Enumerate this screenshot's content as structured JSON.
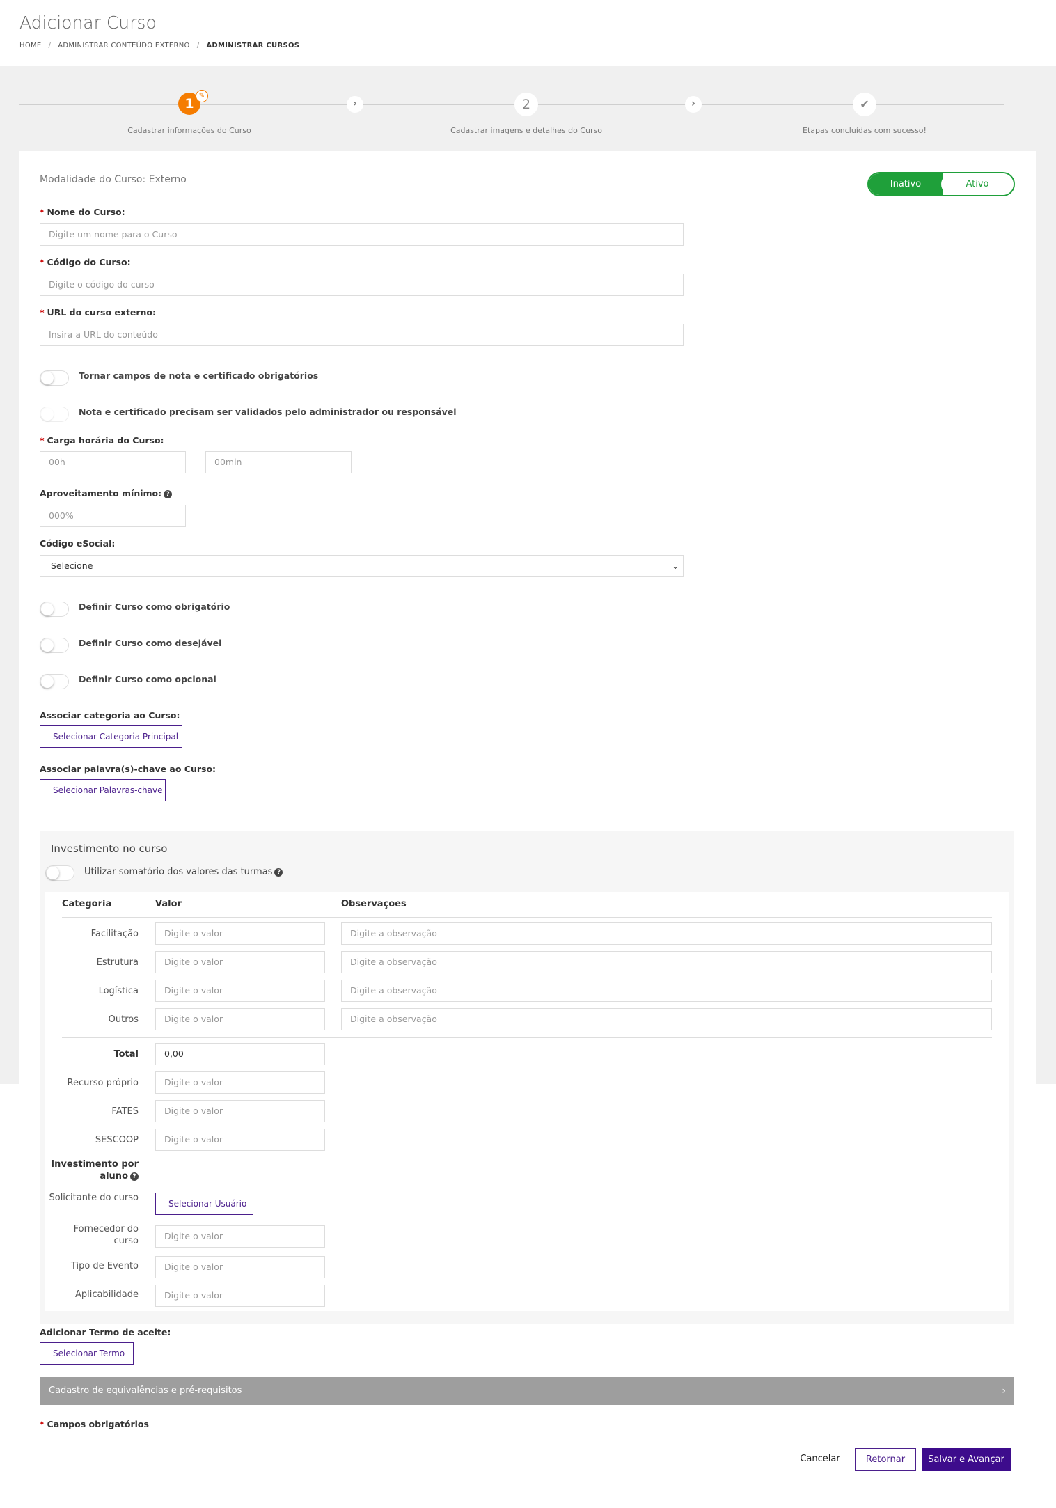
{
  "header": {
    "title": "Adicionar Curso",
    "breadcrumb": [
      "HOME",
      "ADMINISTRAR CONTEÚDO EXTERNO",
      "ADMINISTRAR CURSOS"
    ]
  },
  "stepper": {
    "steps": [
      {
        "number": "1",
        "label": "Cadastrar informações do Curso"
      },
      {
        "number": "2",
        "label": "Cadastrar imagens e detalhes do Curso"
      },
      {
        "number": "",
        "label": "Etapas concluídas com sucesso!"
      }
    ],
    "current_step": 1
  },
  "form": {
    "modalidade": "Modalidade do Curso: Externo",
    "status_switch": {
      "off_label": "Inativo",
      "on_label": "Ativo"
    },
    "nome_label": "Nome do Curso:",
    "nome_placeholder": "Digite um nome para o Curso",
    "codigo_label": "Código do Curso:",
    "codigo_placeholder": "Digite o código do curso",
    "url_label": "URL do curso externo:",
    "url_placeholder": "Insira a URL do conteúdo",
    "toggle_nota_label": "Tornar campos de nota e certificado obrigatórios",
    "toggle_validacao_label": "Nota e certificado precisam ser validados pelo administrador ou responsável",
    "carga_label": "Carga horária do Curso:",
    "carga_horas_placeholder": "00h",
    "carga_min_placeholder": "00min",
    "aproveitamento_label": "Aproveitamento mínimo:",
    "aproveitamento_placeholder": "000%",
    "esocial_label": "Código eSocial:",
    "esocial_value": "Selecione",
    "toggle_obrigatorio_label": "Definir Curso como obrigatório",
    "toggle_desejavel_label": "Definir Curso como desejável",
    "toggle_opcional_label": "Definir Curso como opcional",
    "categoria_label": "Associar categoria ao Curso:",
    "categoria_button": "Selecionar Categoria Principal",
    "palavras_label": "Associar palavra(s)-chave ao Curso:",
    "palavras_button": "Selecionar Palavras-chave",
    "required_symbol": "*"
  },
  "investment": {
    "title": "Investimento no curso",
    "toggle_label": "Utilizar somatório dos valores das turmas",
    "headers": {
      "categoria": "Categoria",
      "valor": "Valor",
      "observacoes": "Observações"
    },
    "rows": [
      {
        "label": "Facilitação",
        "value_placeholder": "Digite o valor",
        "obs_placeholder": "Digite a observação"
      },
      {
        "label": "Estrutura",
        "value_placeholder": "Digite o valor",
        "obs_placeholder": "Digite a observação"
      },
      {
        "label": "Logística",
        "value_placeholder": "Digite o valor",
        "obs_placeholder": "Digite a observação"
      },
      {
        "label": "Outros",
        "value_placeholder": "Digite o valor",
        "obs_placeholder": "Digite a observação"
      }
    ],
    "total_label": "Total",
    "total_value": "0,00",
    "recurso_label": "Recurso próprio",
    "fates_label": "FATES",
    "sescoop_label": "SESCOOP",
    "valor_placeholder": "Digite o valor",
    "por_aluno_label": "Investimento por aluno",
    "solicitante_label": "Solicitante do curso",
    "solicitante_button": "Selecionar Usuário",
    "fornecedor_label": "Fornecedor do curso",
    "tipo_evento_label": "Tipo de Evento",
    "aplicabilidade_label": "Aplicabilidade"
  },
  "termo": {
    "label": "Adicionar Termo de aceite:",
    "button": "Selecionar Termo"
  },
  "accordion": {
    "label": "Cadastro de equivalências e pré-requisitos"
  },
  "footer": {
    "required_note": "Campos obrigatórios",
    "cancel": "Cancelar",
    "back": "Retornar",
    "save": "Salvar e Avançar"
  },
  "colors": {
    "primary": "#3d0c8c",
    "active_green": "#1fa03a",
    "step_current": "#f57c00",
    "required": "#c00"
  }
}
